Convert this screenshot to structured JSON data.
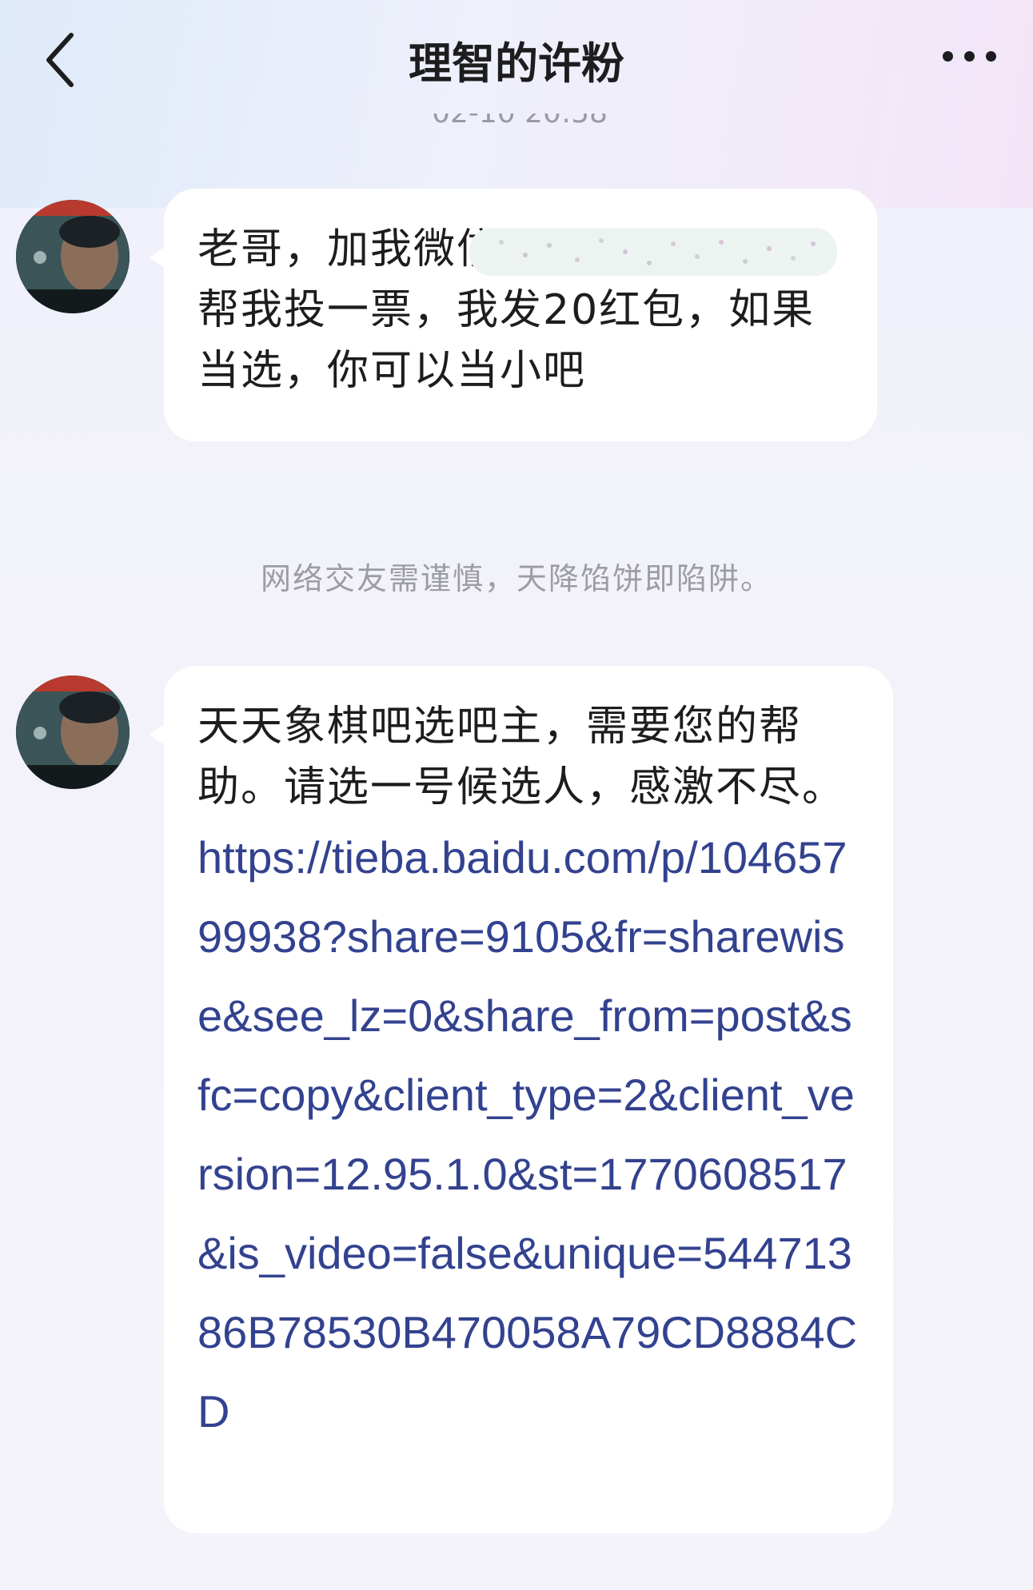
{
  "header": {
    "title": "理智的许粉",
    "timestamp": "02-10 20:58"
  },
  "messages": [
    {
      "text_prefix": "老哥，加我微信461",
      "text_rest": "帮我投一票，我发20红包，如果当选，你可以当小吧"
    },
    {
      "text_prefix": "天天象棋吧选吧主，需要您的帮助。请选一号候选人，感激不尽。",
      "link": "https://tieba.baidu.com/p/10465799938?share=9105&fr=sharewise&see_lz=0&share_from=post&sfc=copy&client_type=2&client_version=12.95.1.0&st=1770608517&is_video=false&unique=54471386B78530B470058A79CD8884CD"
    }
  ],
  "warning": "网络交友需谨慎，天降馅饼即陷阱。",
  "icons": {
    "back": "chevron-left-icon",
    "more": "more-dots-icon"
  },
  "colors": {
    "link": "#33428f",
    "bubble": "#ffffff",
    "text": "#1d1d1f",
    "muted": "#9c9ca6"
  }
}
